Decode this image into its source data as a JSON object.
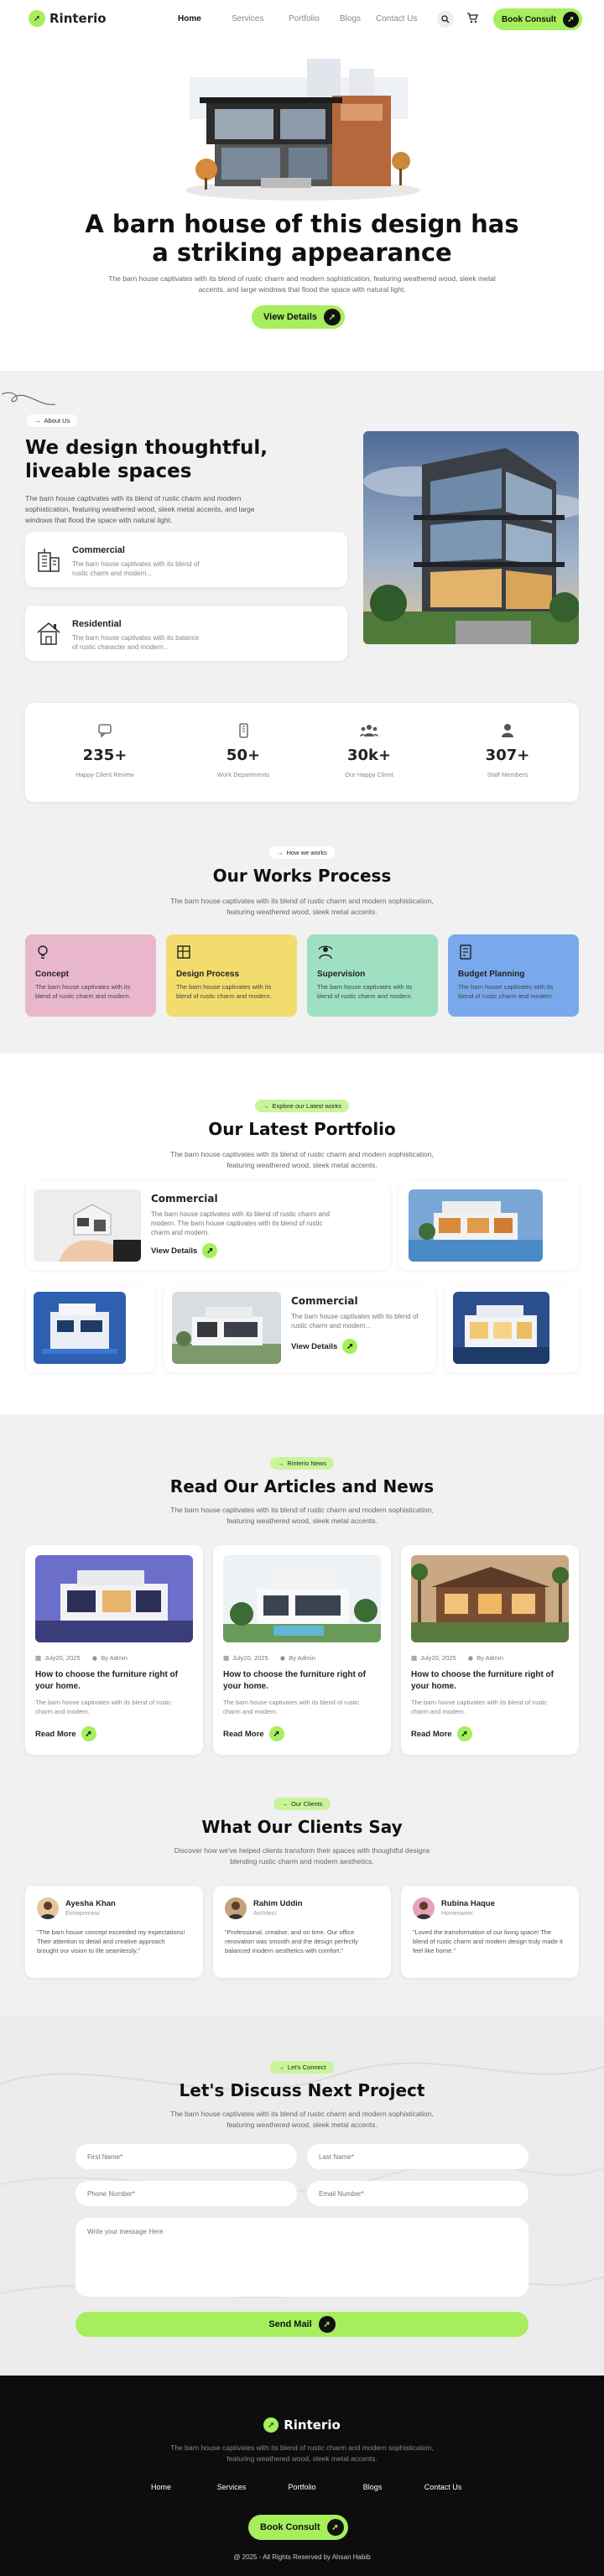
{
  "nav": {
    "brand": "Rinterio",
    "links": [
      "Home",
      "Services",
      "Portfolio",
      "Blogs",
      "Contact Us"
    ],
    "cta": "Book Consult"
  },
  "hero": {
    "title": "A barn house of this design has a striking appearance",
    "text": "The barn house captivates with its blend of rustic charm and modern sophistication, featuring weathered wood, sleek metal accents, and large windows that flood the space with natural light.",
    "button": "View Details"
  },
  "about": {
    "tag": "About Us",
    "title": "We design thoughtful, liveable spaces",
    "text": "The barn house captivates with its blend of rustic charm and modern sophistication, featuring weathered wood, sleek metal accents, and large windows that flood the space with natural light.",
    "cards": [
      {
        "title": "Commercial",
        "text": "The barn house captivates with its blend of rustic charm and modern..."
      },
      {
        "title": "Residential",
        "text": "The barn house captivates with its balance of rustic character and modern..."
      }
    ]
  },
  "stats": [
    {
      "value": "235+",
      "label": "Happy Client Review"
    },
    {
      "value": "50+",
      "label": "Work Departments"
    },
    {
      "value": "30k+",
      "label": "Our Happy Client"
    },
    {
      "value": "307+",
      "label": "Staff Members"
    }
  ],
  "process": {
    "tag": "How we works",
    "title": "Our Works Process",
    "text": "The barn house captivates with its blend of rustic charm and modern sophistication, featuring weathered wood, sleek metal accents.",
    "cards": [
      {
        "title": "Concept",
        "text": "The barn house captivates with its blend of rustic charm and modern.",
        "color": "#e9b7cc"
      },
      {
        "title": "Design Process",
        "text": "The barn house captivates with its blend of rustic charm and modern.",
        "color": "#f3dc6e"
      },
      {
        "title": "Supervision",
        "text": "The barn house captivates with its blend of rustic charm and modern.",
        "color": "#9fe0c3"
      },
      {
        "title": "Budget Planning",
        "text": "The barn house captivates with its blend of rustic charm and modern.",
        "color": "#79a9ec"
      }
    ]
  },
  "portfolio": {
    "tag": "Explore our Latest works",
    "title": "Our Latest Portfolio",
    "text": "The barn house captivates with its blend of rustic charm and modern sophistication, featuring weathered wood, sleek metal accents.",
    "item1": {
      "title": "Commercial",
      "text": "The barn house captivates with its blend of rustic charm and modern. The barn house captivates with its blend of rustic charm and modern.",
      "link": "View Details"
    },
    "item2": {
      "title": "Commercial",
      "text": "The barn house captivates with its blend of rustic charm and modern...",
      "link": "View Details"
    }
  },
  "news": {
    "tag": "Rinterio News",
    "title": "Read Our Articles and News",
    "text": "The barn house captivates with its blend of rustic charm and modern sophistication, featuring weathered wood, sleek metal accents.",
    "posts": [
      {
        "date": "July20, 2025",
        "author": "By Admin",
        "title": "How to choose the furniture right of your home.",
        "text": "The barn house captivates with its blend of rustic charm and modern.",
        "link": "Read More"
      },
      {
        "date": "July20, 2025",
        "author": "By Admin",
        "title": "How to choose the furniture right of your home.",
        "text": "The barn house captivates with its blend of rustic charm and modern.",
        "link": "Read More"
      },
      {
        "date": "July20, 2025",
        "author": "By Admin",
        "title": "How to choose the furniture right of your home.",
        "text": "The barn house captivates with its blend of rustic charm and modern.",
        "link": "Read More"
      }
    ]
  },
  "clients": {
    "tag": "Our Clients",
    "title": "What Our Clients Say",
    "text": "Discover how we've helped clients transform their spaces with thoughtful designs blending rustic charm and modern aesthetics.",
    "items": [
      {
        "name": "Ayesha Khan",
        "role": "Entrepreneur",
        "quote": "\"The barn house concept exceeded my expectations! Their attention to detail and creative approach brought our vision to life seamlessly.\""
      },
      {
        "name": "Rahim Uddin",
        "role": "Architect",
        "quote": "\"Professional, creative, and on time. Our office renovation was smooth and the design perfectly balanced modern aesthetics with comfort.\""
      },
      {
        "name": "Rubina Haque",
        "role": "Homeowner",
        "quote": "\"Loved the transformation of our living space! The blend of rustic charm and modern design truly made it feel like home.\""
      }
    ]
  },
  "contact": {
    "tag": "Let's Connect",
    "title": "Let's Discuss Next Project",
    "text": "The barn house captivates with its blend of rustic charm and modern sophistication, featuring weathered wood, sleek metal accents.",
    "first": "First Name*",
    "last": "Last Name*",
    "phone": "Phone Number*",
    "email": "Email Number*",
    "message": "Write your message Here",
    "button": "Send Mail"
  },
  "footer": {
    "brand": "Rinterio",
    "text": "The barn house captivates with its blend of rustic charm and modern sophistication, featuring weathered wood, sleek metal accents.",
    "links": [
      "Home",
      "Services",
      "Portfolio",
      "Blogs",
      "Contact Us"
    ],
    "cta": "Book Consult",
    "copyright": "@ 2025 - All Rights Reserved by Ahsan Habib"
  },
  "colors": {
    "accent": "#a6ee5c",
    "dark": "#111111",
    "section": "#f1f1f1"
  }
}
